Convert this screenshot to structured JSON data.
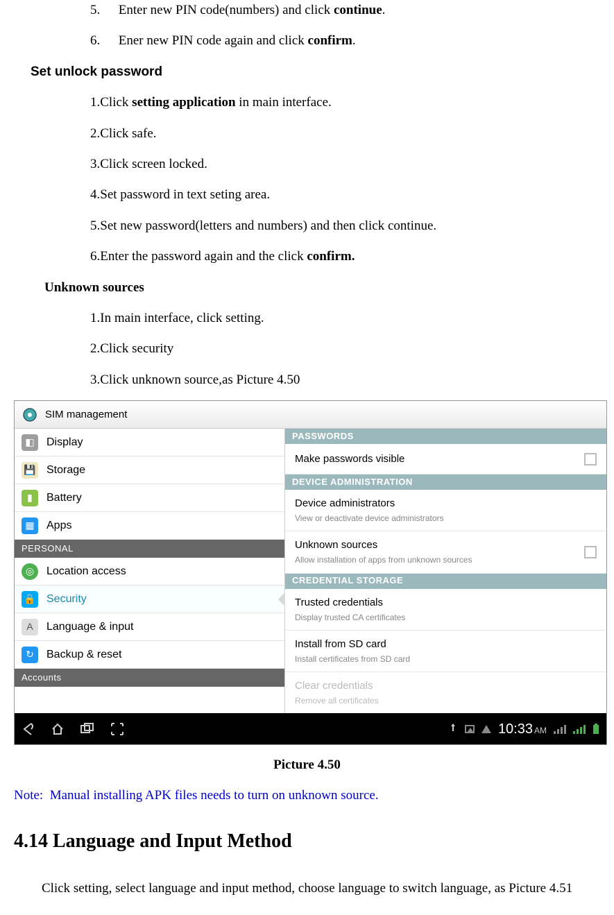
{
  "doc": {
    "item5_num": "5.",
    "item5_a": "Enter new PIN code(numbers) and click ",
    "item5_b": "continue",
    "item5_c": ".",
    "item6_num": "6.",
    "item6_a": "Ener new PIN code again and click ",
    "item6_b": "confirm",
    "item6_c": ".",
    "h_unlock": "Set unlock password",
    "u1_a": "1.Click ",
    "u1_b": "setting application",
    "u1_c": " in main interface.",
    "u2": "2.Click safe.",
    "u3": "3.Click screen locked.",
    "u4": "4.Set password in text seting area.",
    "u5": "5.Set new password(letters and numbers) and then click continue.",
    "u6_a": "6.Enter the password again and the click ",
    "u6_b": "confirm.",
    "h_unknown": "Unknown sources",
    "k1": "1.In main interface, click setting.",
    "k2": "2.Click security",
    "k3": "3.Click unknown source,as Picture 4.50",
    "caption": "Picture 4.50",
    "note_a": "Note:",
    "note_b": "Manual installing APK files needs to turn on unknown source.",
    "h414": "4.14 Language and Input Method",
    "para": "Click setting, select language and input method, choose language to switch language, as Picture 4.51"
  },
  "screenshot": {
    "header": "SIM management",
    "left": {
      "items": [
        {
          "label": "Display",
          "icon_bg": "#9e9e9e"
        },
        {
          "label": "Storage",
          "icon_bg": "#8bc34a"
        },
        {
          "label": "Battery",
          "icon_bg": "#8bc34a"
        },
        {
          "label": "Apps",
          "icon_bg": "#2196f3"
        }
      ],
      "section": "PERSONAL",
      "items2": [
        {
          "label": "Location access",
          "icon_bg": "#4caf50"
        },
        {
          "label": "Security",
          "icon_bg": "#03a9f4",
          "selected": true
        },
        {
          "label": "Language & input",
          "icon_bg": "#9e9e9e"
        },
        {
          "label": "Backup & reset",
          "icon_bg": "#2196f3"
        }
      ],
      "section2": "Accounts"
    },
    "right": {
      "sec1": "PASSWORDS",
      "r1": {
        "title": "Make passwords visible"
      },
      "sec2": "DEVICE ADMINISTRATION",
      "r2": {
        "title": "Device administrators",
        "sub": "View or deactivate device administrators"
      },
      "r3": {
        "title": "Unknown sources",
        "sub": "Allow installation of apps from unknown sources"
      },
      "sec3": "CREDENTIAL STORAGE",
      "r4": {
        "title": "Trusted credentials",
        "sub": "Display trusted CA certificates"
      },
      "r5": {
        "title": "Install from SD card",
        "sub": "Install certificates from SD card"
      },
      "r6": {
        "title": "Clear credentials",
        "sub": "Remove all certificates"
      }
    },
    "nav": {
      "time": "10:33",
      "ampm": "AM"
    }
  }
}
